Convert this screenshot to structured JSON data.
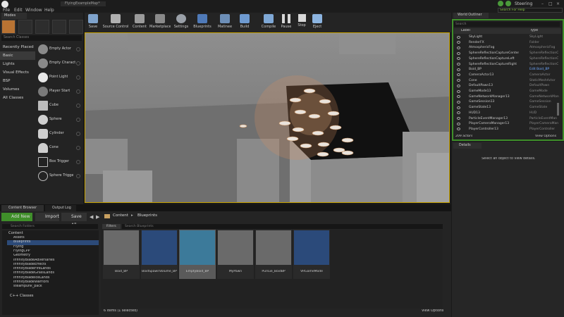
{
  "window": {
    "title_tab": "FlyingExampleMap*",
    "search_help_placeholder": "Search For Help",
    "profile_label": "Steering"
  },
  "menu": [
    "File",
    "Edit",
    "Window",
    "Help"
  ],
  "modes": {
    "tab_label": "Modes",
    "search_placeholder": "Search Classes",
    "categories": [
      "Recently Placed",
      "Basic",
      "Lights",
      "Visual Effects",
      "BSP",
      "Volumes",
      "All Classes"
    ],
    "selected_category": "Basic",
    "items": [
      "Empty Actor",
      "Empty Charact",
      "Point Light",
      "Player Start",
      "Cube",
      "Sphere",
      "Cylinder",
      "Cone",
      "Box Trigger",
      "Sphere Trigge"
    ]
  },
  "toolbar": {
    "buttons": [
      "Save",
      "Source Control",
      "Content",
      "Marketplace",
      "Settings",
      "Blueprints",
      "Matinee",
      "Build",
      "Compile",
      "Pause",
      "Stop",
      "Eject"
    ]
  },
  "outliner": {
    "tab_label": "World Outliner",
    "search_placeholder": "Search",
    "col_label": "Label",
    "col_type": "Type",
    "rows": [
      {
        "label": "SkyLight",
        "type": "SkyLight"
      },
      {
        "label": "RenderFX",
        "type": "Folder"
      },
      {
        "label": "AtmosphericFog",
        "type": "AtmosphericFog"
      },
      {
        "label": "SphereReflectionCaptureCenter",
        "type": "SphereReflectionC"
      },
      {
        "label": "SphereReflectionCaptureLeft",
        "type": "SphereReflectionC"
      },
      {
        "label": "SphereReflectionCaptureRight",
        "type": "SphereReflectionC"
      },
      {
        "label": "Boid_BP",
        "type": "Edit Boid_BP"
      },
      {
        "label": "CameraActor13",
        "type": "CameraActor"
      },
      {
        "label": "Cone",
        "type": "StaticMeshActor"
      },
      {
        "label": "DefaultPawn13",
        "type": "DefaultPawn"
      },
      {
        "label": "GameMode13",
        "type": "GameMode"
      },
      {
        "label": "GameNetworkManager13",
        "type": "GameNetworkMan"
      },
      {
        "label": "GameSession13",
        "type": "GameSession"
      },
      {
        "label": "GameState13",
        "type": "GameState"
      },
      {
        "label": "HUD13",
        "type": "HUD"
      },
      {
        "label": "ParticleEventManager13",
        "type": "ParticleEventMan"
      },
      {
        "label": "PlayerCameraManager13",
        "type": "PlayerCameraMan"
      },
      {
        "label": "PlayerController13",
        "type": "PlayerController"
      }
    ],
    "actor_count": "209 actors",
    "view_options": "View Options"
  },
  "details": {
    "tab_label": "Details",
    "empty_message": "Select an object to view details."
  },
  "content_browser": {
    "tabs": [
      "Content Browser",
      "Output Log"
    ],
    "add_new": "Add New",
    "import": "Import",
    "save_all": "Save All",
    "path": [
      "Content",
      "Blueprints"
    ],
    "search_folders_placeholder": "Search Folders",
    "filters_label": "Filters",
    "search_assets_placeholder": "Search Blueprints",
    "tree_root": "Content",
    "tree_items": [
      "Assets",
      "Blueprints",
      "Flying",
      "FlyingCPP",
      "Geometry",
      "InfinityBladeAdversaries",
      "InfinityBladeEffects",
      "InfinityBladeFireLands",
      "InfinityBladeGrassLands",
      "InfinityBladeIceLands",
      "InfinityBladeWarriors",
      "steampunk_pack"
    ],
    "tree_cpp": "C++ Classes",
    "assets": [
      "Boid_BP",
      "BoidSpawnVolume_BP",
      "EmptyBoid_BP",
      "MyPawn",
      "Pursue_BoidBP",
      "VRGameMode"
    ],
    "item_count": "6 items (1 selected)",
    "view_options": "View Options"
  },
  "colors": {
    "accent_yellow": "#c9a300",
    "add_new_green": "#3f8f2a",
    "selection_blue": "#2c4a78"
  }
}
